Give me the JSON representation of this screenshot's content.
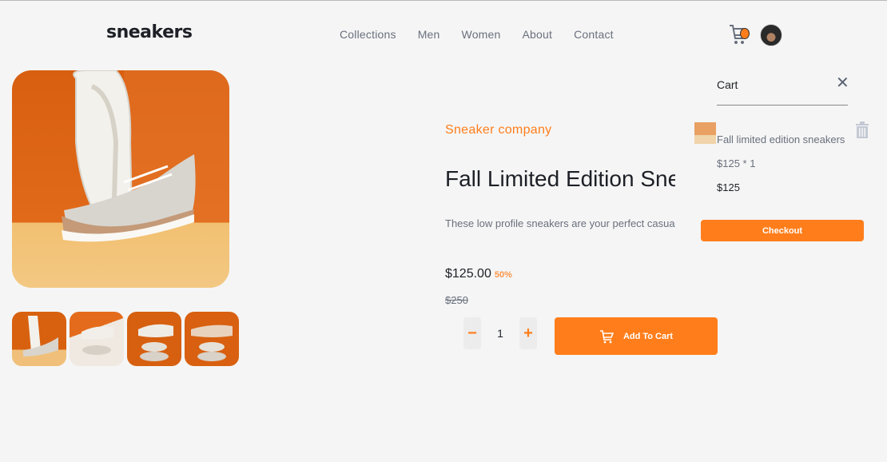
{
  "brand": {
    "logo_text": "sneakers"
  },
  "nav": {
    "items": [
      {
        "label": "Collections"
      },
      {
        "label": "Men"
      },
      {
        "label": "Women"
      },
      {
        "label": "About"
      },
      {
        "label": "Contact"
      }
    ]
  },
  "header": {
    "cart_icon": "cart-icon",
    "avatar": "user-avatar"
  },
  "gallery": {
    "main_image": "sneaker-main-image",
    "thumbnails": [
      {
        "name": "sneaker-thumb-1"
      },
      {
        "name": "sneaker-thumb-2"
      },
      {
        "name": "sneaker-thumb-3"
      },
      {
        "name": "sneaker-thumb-4"
      }
    ]
  },
  "product": {
    "company": "Sneaker company",
    "title": "Fall Limited Edition Sneakers",
    "description": "These low profile sneakers are your perfect casual wear companion. Featuring a durable rubber outer sole they'll withstand everything the weather can offer.",
    "price": "$125.00",
    "discount": "50%",
    "old_price": "$250"
  },
  "quantity": {
    "minus": "−",
    "value": "1",
    "plus": "+"
  },
  "actions": {
    "add_to_cart": "Add To Cart"
  },
  "cart": {
    "title": "Cart",
    "close": "✕",
    "item_name": "Fall limited edition sneakers",
    "item_qty": "$125 * 1",
    "item_total": "$125",
    "checkout": "Checkout"
  },
  "colors": {
    "accent": "#ff7e1b",
    "text_dark": "#1d2026",
    "text_muted": "#69707d",
    "background": "#f5f5f5"
  }
}
